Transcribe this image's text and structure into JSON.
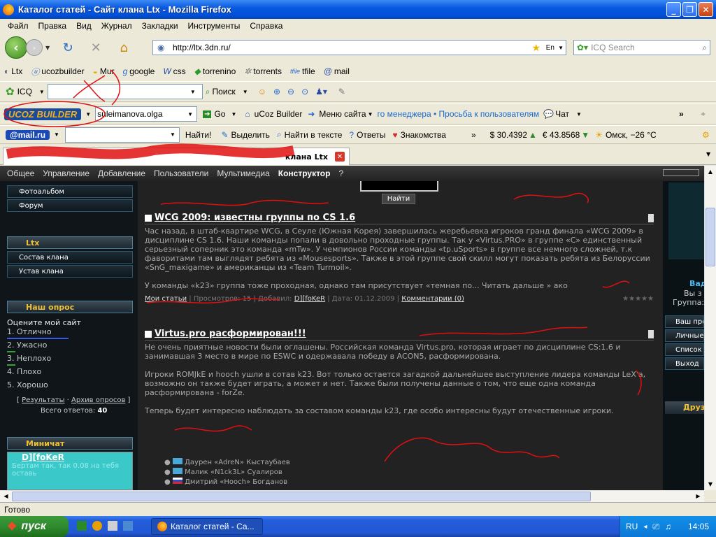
{
  "window": {
    "title": "Каталог статей - Сайт клана Ltx - Mozilla Firefox"
  },
  "menubar": [
    "Файл",
    "Правка",
    "Вид",
    "Журнал",
    "Закладки",
    "Инструменты",
    "Справка"
  ],
  "nav": {
    "url": "http://ltx.3dn.ru/",
    "search_placeholder": "ICQ Search",
    "lang": "En"
  },
  "bookmarks": [
    "Ltx",
    "ucozbuilder",
    "Mur",
    "google",
    "css",
    "torrenino",
    "torrents",
    "tfile",
    "mail"
  ],
  "toolbar1": {
    "icq": "ICQ",
    "search": "Поиск"
  },
  "toolbar2": {
    "logo": "UCOZ BUILDER",
    "user": "suleimanova.olga",
    "go": "Go",
    "ucoz_builder": "uCoz Builder",
    "site_menu": "Меню сайта",
    "ticker": "го менеджера • Просьба к пользователям",
    "chat": "Чат",
    "more": "»"
  },
  "toolbar3": {
    "mail": "@mail.ru",
    "find": "Найти!",
    "highlight": "Выделить",
    "find_text": "Найти в тексте",
    "answers": "Ответы",
    "dating": "Знакомства",
    "more": "»",
    "usd": "$ 30.4392",
    "eur": "€ 43.8568",
    "weather": "Омск, −26 °C"
  },
  "tab": {
    "title": "клана Ltx"
  },
  "site": {
    "menu": [
      "Общее",
      "Управление",
      "Добавление",
      "Пользователи",
      "Мультимедиа"
    ],
    "menu_active": "Конструктор",
    "menu_help": "?",
    "search_button": "Найти",
    "left": {
      "items_top": [
        "Фотоальбом",
        "Форум"
      ],
      "clan_header": "Ltx",
      "clan_items": [
        "Состав клана",
        "Устав клана"
      ],
      "poll_header": "Наш опрос",
      "poll_question": "Оцените мой сайт",
      "poll_options": [
        "1. Отлично",
        "2. Ужасно",
        "3. Неплохо",
        "4. Плохо",
        "5. Хорошо"
      ],
      "poll_results": "Результаты",
      "poll_archive": "Архив опросов",
      "poll_total_label": "Всего ответов:",
      "poll_total": "40",
      "minichat_header": "Миничат",
      "minichat_user": "D][foKeR",
      "minichat_text": "Бертам так, так 0.08 на тебя оставь"
    },
    "articles": [
      {
        "title": "WCG 2009: известны группы по CS 1.6",
        "body": "Час назад, в штаб-квартире WCG, в Сеуле (Южная Корея) завершилась жеребьевка игроков гранд финала «WCG 2009» в дисциплине CS 1.6. Наши команды попали в довольно проходные группы. Так у «Virtus.PRO» в группе «C» единственный серьезный соперник это команда «mTw». У чемпионов России команды «tp.uSports» в группе все немного сложней, т.к фаворитами там выглядят ребята из «Mousesports». Также в этой группе свой скилл могут показать ребята из Белоруссии «SnG_maxigame» и американцы из «Team Turmoil».",
        "body2": "У команды «k23» группа тоже проходная, однако там присутствует «темная по... Читать дальше » ако",
        "category": "Мои статьи",
        "views": "Просмотров: 15",
        "added_by_label": "Добавил:",
        "author": "D][foKeR",
        "date": "Дата: 01.12.2009",
        "comments": "Комментарии (0)"
      },
      {
        "title": "Virtus.pro расформирован!!!",
        "body": "Не очень приятные новости были оглашены. Российская команда Virtus.pro, которая играет по дисциплине CS:1.6 и занимавшая 3 место в мире по ESWC и одержавала победу в ACON5, расформирована.",
        "body2": "Игроки ROMJkE и hooch ушли в сотав k23. Вот только остается загадкой дальнейшее выступление лидера команды LeX'a, возможно он также будет играть, а может и нет. Также были получены данные о том, что еще одна команда расформирована - forZe.",
        "body3": "Теперь будет интересно наблюдать за составом команды k23, где особо интересны будут отечественные игроки.",
        "players": [
          "Даурен «AdreN» Кыстаубаев",
          "Малик «N1ck3L» Суалиров",
          "Дмитрий «Hooch» Богданов"
        ]
      }
    ],
    "right": {
      "texts": [
        "Вад",
        "Вы з",
        "Группа:"
      ],
      "items": [
        "Ваш про",
        "Личные",
        "Список",
        "Выход"
      ],
      "friends": "Друз"
    }
  },
  "status": "Готово",
  "taskbar": {
    "start": "пуск",
    "task": "Каталог статей - Са...",
    "lang": "RU",
    "time": "14:05"
  }
}
